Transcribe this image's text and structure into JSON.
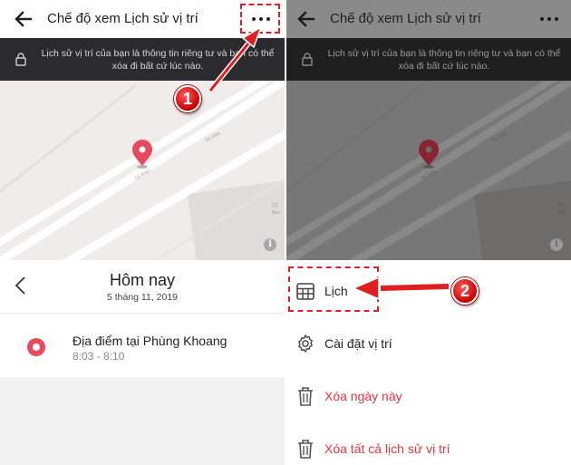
{
  "colors": {
    "accent_red": "#e64a5c",
    "danger_text": "#e5343f",
    "annotation_red": "#e02020",
    "banner_bg": "#2b2b2d",
    "overlay_gray": "#777777"
  },
  "left_screen": {
    "appbar": {
      "back_icon": "arrow-left-icon",
      "title": "Chế độ xem Lịch sử vị trí",
      "more_icon": "more-horizontal-icon"
    },
    "banner": {
      "lock_icon": "lock-icon",
      "text": "Lịch sử vị trí của bạn là thông tin riêng tư và bạn có thể xóa đi bất cứ lúc nào."
    },
    "map": {
      "road_labels": [
        "Tố Hữu",
        "Tố Hữu"
      ],
      "side_label_1": "CC",
      "side_label_2": "Bac",
      "pin_icon": "map-pin-icon",
      "info_glyph": "i"
    },
    "date_nav": {
      "prev_icon": "chevron-left-icon",
      "title": "Hôm nay",
      "subtitle": "5 tháng 11, 2019"
    },
    "place": {
      "name": "Địa điểm tại Phùng Khoang",
      "time": "8:03 - 8:10"
    }
  },
  "right_screen": {
    "appbar": {
      "title": "Chế độ xem Lịch sử vị trí"
    },
    "banner": {
      "text": "Lịch sử vị trí của bạn là thông tin riêng tư và bạn có thể xóa đi bất cứ lúc nào."
    },
    "menu": [
      {
        "label": "Lịch",
        "icon": "calendar-grid-icon",
        "danger": false
      },
      {
        "label": "Cài đặt vị trí",
        "icon": "gear-icon",
        "danger": false
      },
      {
        "label": "Xóa ngày này",
        "icon": "trash-icon",
        "danger": true
      },
      {
        "label": "Xóa tất cả lịch sử vị trí",
        "icon": "trash-icon",
        "danger": true
      }
    ]
  },
  "annotations": [
    {
      "number": "1"
    },
    {
      "number": "2"
    }
  ]
}
